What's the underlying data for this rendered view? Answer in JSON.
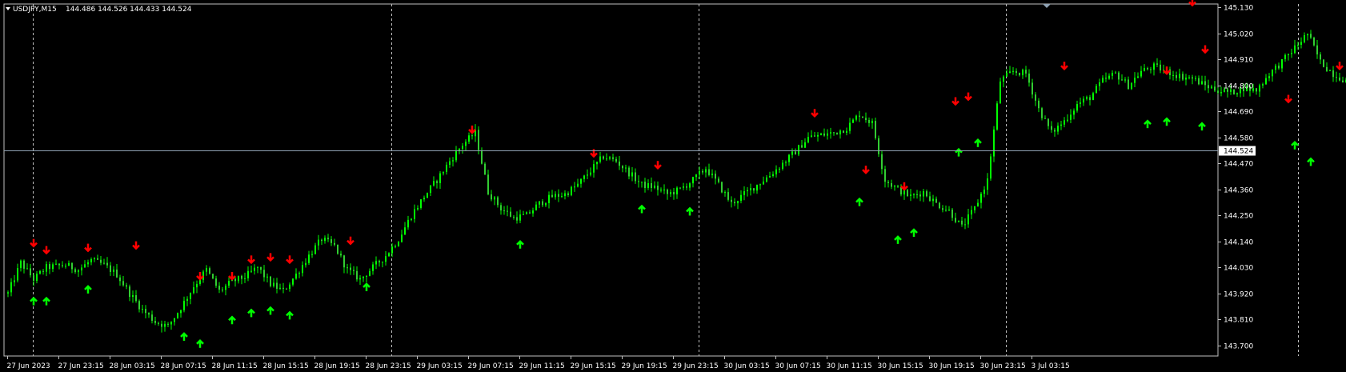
{
  "window": {
    "symbol_label": "USDJPY,M15",
    "ohlc_label": "144.486 144.526 144.433 144.524"
  },
  "colors": {
    "background": "#000000",
    "frame": "#c0c0c0",
    "grid": "#c0c0c0",
    "candle_bull": "#00ff00",
    "candle_bear": "#33cc33",
    "bid_line": "#8fa1b2",
    "arrow_up": "#00ff00",
    "arrow_down": "#ff0000",
    "price_label_bg": "#ffffff",
    "price_label_text": "#000000"
  },
  "chart_data": {
    "type": "candlestick",
    "symbol": "USDJPY",
    "timeframe": "M15",
    "current_price": 144.524,
    "current_price_label": "144.524",
    "ylim": [
      143.655,
      145.145
    ],
    "yticks": [
      "145.130",
      "145.020",
      "144.910",
      "144.800",
      "144.690",
      "144.580",
      "144.470",
      "144.360",
      "144.250",
      "144.140",
      "144.030",
      "143.920",
      "143.810",
      "143.700"
    ],
    "xticks": [
      "27 Jun 2023",
      "27 Jun 23:15",
      "28 Jun 03:15",
      "28 Jun 07:15",
      "28 Jun 11:15",
      "28 Jun 15:15",
      "28 Jun 19:15",
      "28 Jun 23:15",
      "29 Jun 03:15",
      "29 Jun 07:15",
      "29 Jun 11:15",
      "29 Jun 15:15",
      "29 Jun 19:15",
      "29 Jun 23:15",
      "30 Jun 03:15",
      "30 Jun 07:15",
      "30 Jun 11:15",
      "30 Jun 15:15",
      "30 Jun 19:15",
      "30 Jun 23:15",
      "3 Jul 03:15"
    ],
    "day_separators_after_tick": [
      0.5,
      7.5,
      13.5,
      19.5
    ],
    "bars_per_tick": 16,
    "path": [
      [
        0,
        143.92
      ],
      [
        4,
        144.05
      ],
      [
        8,
        143.98
      ],
      [
        12,
        144.03
      ],
      [
        18,
        144.04
      ],
      [
        22,
        144.02
      ],
      [
        26,
        144.06
      ],
      [
        30,
        144.04
      ],
      [
        34,
        144.0
      ],
      [
        38,
        143.92
      ],
      [
        42,
        143.85
      ],
      [
        46,
        143.8
      ],
      [
        50,
        143.78
      ],
      [
        54,
        143.86
      ],
      [
        58,
        143.95
      ],
      [
        62,
        144.02
      ],
      [
        66,
        143.93
      ],
      [
        70,
        143.97
      ],
      [
        74,
        143.99
      ],
      [
        78,
        144.03
      ],
      [
        82,
        143.96
      ],
      [
        86,
        143.93
      ],
      [
        90,
        144.0
      ],
      [
        94,
        144.08
      ],
      [
        98,
        144.15
      ],
      [
        102,
        144.12
      ],
      [
        106,
        144.02
      ],
      [
        110,
        143.98
      ],
      [
        114,
        144.03
      ],
      [
        118,
        144.08
      ],
      [
        122,
        144.15
      ],
      [
        126,
        144.25
      ],
      [
        130,
        144.33
      ],
      [
        134,
        144.4
      ],
      [
        138,
        144.48
      ],
      [
        142,
        144.55
      ],
      [
        146,
        144.6
      ],
      [
        150,
        144.35
      ],
      [
        154,
        144.28
      ],
      [
        158,
        144.24
      ],
      [
        162,
        144.25
      ],
      [
        166,
        144.3
      ],
      [
        170,
        144.33
      ],
      [
        174,
        144.34
      ],
      [
        178,
        144.38
      ],
      [
        182,
        144.44
      ],
      [
        186,
        144.5
      ],
      [
        190,
        144.48
      ],
      [
        194,
        144.43
      ],
      [
        198,
        144.38
      ],
      [
        202,
        144.37
      ],
      [
        206,
        144.34
      ],
      [
        210,
        144.36
      ],
      [
        214,
        144.4
      ],
      [
        218,
        144.45
      ],
      [
        222,
        144.38
      ],
      [
        226,
        144.3
      ],
      [
        230,
        144.34
      ],
      [
        234,
        144.38
      ],
      [
        238,
        144.42
      ],
      [
        242,
        144.47
      ],
      [
        246,
        144.52
      ],
      [
        250,
        144.58
      ],
      [
        254,
        144.59
      ],
      [
        258,
        144.6
      ],
      [
        262,
        144.62
      ],
      [
        266,
        144.68
      ],
      [
        270,
        144.64
      ],
      [
        274,
        144.4
      ],
      [
        278,
        144.36
      ],
      [
        282,
        144.33
      ],
      [
        286,
        144.35
      ],
      [
        290,
        144.3
      ],
      [
        294,
        144.27
      ],
      [
        298,
        144.2
      ],
      [
        302,
        144.28
      ],
      [
        306,
        144.4
      ],
      [
        310,
        144.82
      ],
      [
        314,
        144.86
      ],
      [
        318,
        144.85
      ],
      [
        322,
        144.7
      ],
      [
        326,
        144.6
      ],
      [
        330,
        144.65
      ],
      [
        334,
        144.72
      ],
      [
        338,
        144.75
      ],
      [
        342,
        144.82
      ],
      [
        346,
        144.85
      ],
      [
        350,
        144.8
      ],
      [
        354,
        144.86
      ],
      [
        358,
        144.88
      ],
      [
        362,
        144.86
      ],
      [
        366,
        144.84
      ],
      [
        370,
        144.83
      ],
      [
        374,
        144.8
      ],
      [
        378,
        144.78
      ],
      [
        382,
        144.77
      ],
      [
        386,
        144.79
      ],
      [
        390,
        144.78
      ],
      [
        394,
        144.85
      ],
      [
        398,
        144.9
      ],
      [
        402,
        144.96
      ],
      [
        406,
        145.02
      ],
      [
        410,
        144.9
      ],
      [
        414,
        144.85
      ],
      [
        418,
        144.82
      ],
      [
        422,
        144.78
      ],
      [
        426,
        144.74
      ],
      [
        430,
        144.7
      ],
      [
        434,
        144.68
      ],
      [
        438,
        144.66
      ],
      [
        442,
        144.55
      ],
      [
        446,
        144.58
      ],
      [
        450,
        144.75
      ],
      [
        454,
        144.88
      ],
      [
        458,
        144.85
      ],
      [
        462,
        144.7
      ],
      [
        466,
        144.68
      ],
      [
        470,
        144.72
      ],
      [
        474,
        144.7
      ],
      [
        478,
        144.66
      ],
      [
        482,
        144.68
      ],
      [
        486,
        144.72
      ],
      [
        490,
        144.55
      ],
      [
        494,
        144.4
      ],
      [
        498,
        144.37
      ],
      [
        502,
        144.45
      ],
      [
        506,
        144.55
      ],
      [
        510,
        144.58
      ],
      [
        514,
        144.47
      ],
      [
        518,
        144.35
      ],
      [
        522,
        144.32
      ],
      [
        526,
        144.28
      ],
      [
        530,
        144.3
      ],
      [
        534,
        144.29
      ],
      [
        538,
        144.27
      ],
      [
        542,
        144.3
      ],
      [
        546,
        144.32
      ],
      [
        550,
        144.3
      ],
      [
        554,
        144.28
      ],
      [
        558,
        144.32
      ],
      [
        562,
        144.35
      ],
      [
        566,
        144.38
      ],
      [
        570,
        144.45
      ],
      [
        574,
        144.35
      ],
      [
        578,
        144.45
      ],
      [
        582,
        144.52
      ]
    ],
    "signals": [
      {
        "type": "buy",
        "bar": 8,
        "price": 143.9
      },
      {
        "type": "buy",
        "bar": 12,
        "price": 143.9
      },
      {
        "type": "sell",
        "bar": 8,
        "price": 144.12
      },
      {
        "type": "sell",
        "bar": 12,
        "price": 144.09
      },
      {
        "type": "buy",
        "bar": 25,
        "price": 143.95
      },
      {
        "type": "sell",
        "bar": 25,
        "price": 144.1
      },
      {
        "type": "sell",
        "bar": 40,
        "price": 144.11
      },
      {
        "type": "buy",
        "bar": 55,
        "price": 143.75
      },
      {
        "type": "buy",
        "bar": 60,
        "price": 143.72
      },
      {
        "type": "sell",
        "bar": 60,
        "price": 143.98
      },
      {
        "type": "buy",
        "bar": 70,
        "price": 143.82
      },
      {
        "type": "buy",
        "bar": 76,
        "price": 143.85
      },
      {
        "type": "sell",
        "bar": 70,
        "price": 143.98
      },
      {
        "type": "sell",
        "bar": 76,
        "price": 144.05
      },
      {
        "type": "buy",
        "bar": 82,
        "price": 143.86
      },
      {
        "type": "buy",
        "bar": 88,
        "price": 143.84
      },
      {
        "type": "sell",
        "bar": 82,
        "price": 144.06
      },
      {
        "type": "sell",
        "bar": 88,
        "price": 144.05
      },
      {
        "type": "sell",
        "bar": 107,
        "price": 144.13
      },
      {
        "type": "buy",
        "bar": 112,
        "price": 143.96
      },
      {
        "type": "sell",
        "bar": 145,
        "price": 144.6
      },
      {
        "type": "buy",
        "bar": 160,
        "price": 144.14
      },
      {
        "type": "sell",
        "bar": 183,
        "price": 144.5
      },
      {
        "type": "sell",
        "bar": 203,
        "price": 144.45
      },
      {
        "type": "buy",
        "bar": 198,
        "price": 144.29
      },
      {
        "type": "buy",
        "bar": 213,
        "price": 144.28
      },
      {
        "type": "sell",
        "bar": 252,
        "price": 144.67
      },
      {
        "type": "buy",
        "bar": 266,
        "price": 144.32
      },
      {
        "type": "sell",
        "bar": 268,
        "price": 144.43
      },
      {
        "type": "sell",
        "bar": 280,
        "price": 144.36
      },
      {
        "type": "buy",
        "bar": 278,
        "price": 144.16
      },
      {
        "type": "buy",
        "bar": 283,
        "price": 144.19
      },
      {
        "type": "sell",
        "bar": 296,
        "price": 144.72
      },
      {
        "type": "sell",
        "bar": 300,
        "price": 144.74
      },
      {
        "type": "buy",
        "bar": 297,
        "price": 144.53
      },
      {
        "type": "buy",
        "bar": 303,
        "price": 144.57
      },
      {
        "type": "sell",
        "bar": 330,
        "price": 144.87
      },
      {
        "type": "buy",
        "bar": 356,
        "price": 144.65
      },
      {
        "type": "buy",
        "bar": 362,
        "price": 144.66
      },
      {
        "type": "sell",
        "bar": 362,
        "price": 144.85
      },
      {
        "type": "sell",
        "bar": 370,
        "price": 145.14
      },
      {
        "type": "sell",
        "bar": 374,
        "price": 144.94
      },
      {
        "type": "buy",
        "bar": 373,
        "price": 144.64
      },
      {
        "type": "sell",
        "bar": 400,
        "price": 144.73
      },
      {
        "type": "buy",
        "bar": 402,
        "price": 144.56
      },
      {
        "type": "sell",
        "bar": 416,
        "price": 144.87
      },
      {
        "type": "buy",
        "bar": 407,
        "price": 144.49
      },
      {
        "type": "buy",
        "bar": 432,
        "price": 144.59
      },
      {
        "type": "sell",
        "bar": 440,
        "price": 144.76
      },
      {
        "type": "sell",
        "bar": 470,
        "price": 144.56
      },
      {
        "type": "buy",
        "bar": 457,
        "price": 144.24
      },
      {
        "type": "buy",
        "bar": 492,
        "price": 144.19
      },
      {
        "type": "sell",
        "bar": 497,
        "price": 144.32
      },
      {
        "type": "buy",
        "bar": 505,
        "price": 144.2
      },
      {
        "type": "sell",
        "bar": 518,
        "price": 144.45
      },
      {
        "type": "buy",
        "bar": 522,
        "price": 144.17
      }
    ]
  }
}
